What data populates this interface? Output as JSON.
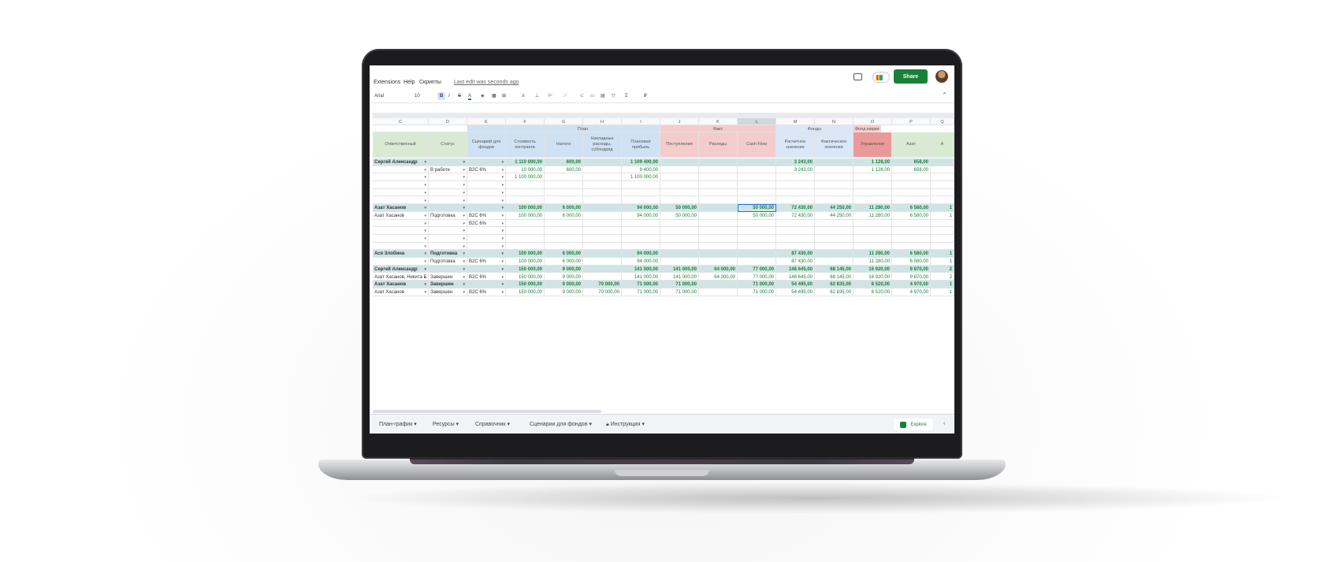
{
  "menu": {
    "items": [
      "Extensions",
      "Help",
      "Скрипты"
    ],
    "last_edit": "Last edit was seconds ago",
    "share": "Share"
  },
  "toolbar": {
    "font": "Arial",
    "size": "10",
    "bold": "B",
    "italic": "I",
    "strike": "S",
    "color": "A"
  },
  "columns": [
    {
      "letter": "C",
      "label": "Ответственный"
    },
    {
      "letter": "D",
      "label": "Статус"
    },
    {
      "letter": "E",
      "label": "Сценарий для фондов"
    },
    {
      "letter": "F",
      "label": "Стоимость контракта"
    },
    {
      "letter": "G",
      "label": "Налоги"
    },
    {
      "letter": "H",
      "label": "Накладные расходы, субподряд"
    },
    {
      "letter": "I",
      "label": "Плановая прибыль"
    },
    {
      "letter": "J",
      "label": "Поступления"
    },
    {
      "letter": "K",
      "label": "Расходы"
    },
    {
      "letter": "L",
      "label": "Cash Flow"
    },
    {
      "letter": "M",
      "label": "Расчетное значение"
    },
    {
      "letter": "N",
      "label": "Фактическое значение"
    },
    {
      "letter": "O",
      "label": "Управление"
    },
    {
      "letter": "P",
      "label": "Азат"
    },
    {
      "letter": "Q",
      "label": "А"
    }
  ],
  "groups": {
    "plan": "План",
    "fact": "Факт",
    "funds": "Фонды",
    "brand": "Фонд марки"
  },
  "rows": [
    {
      "g": true,
      "c": [
        "Сергей Александр",
        "",
        "",
        "1 110 000,00",
        "600,00",
        "",
        "1 109 400,00",
        "",
        "",
        "",
        "3 243,00",
        "",
        "1 128,00",
        "658,00",
        ""
      ]
    },
    {
      "g": false,
      "c": [
        "",
        "В работе",
        "B2C 6%",
        "10 000,00",
        "600,00",
        "",
        "9 400,00",
        "",
        "",
        "",
        "3 243,00",
        "",
        "1 128,00",
        "658,00",
        ""
      ]
    },
    {
      "g": false,
      "c": [
        "",
        "",
        "",
        "1 100 000,00",
        "",
        "",
        "1 100 000,00",
        "",
        "",
        "",
        "",
        "",
        "",
        "",
        ""
      ]
    },
    {
      "g": false,
      "c": [
        "",
        "",
        "",
        "",
        "",
        "",
        "",
        "",
        "",
        "",
        "",
        "",
        "",
        "",
        ""
      ]
    },
    {
      "g": false,
      "c": [
        "",
        "",
        "",
        "",
        "",
        "",
        "",
        "",
        "",
        "",
        "",
        "",
        "",
        "",
        ""
      ]
    },
    {
      "g": false,
      "c": [
        "",
        "",
        "",
        "",
        "",
        "",
        "",
        "",
        "",
        "",
        "",
        "",
        "",
        "",
        ""
      ]
    },
    {
      "g": true,
      "c": [
        "Азат Хасанов",
        "",
        "",
        "100 000,00",
        "6 000,00",
        "",
        "94 000,00",
        "50 000,00",
        "",
        "50 000,00",
        "72 430,00",
        "44 250,00",
        "11 280,00",
        "6 580,00",
        "1"
      ]
    },
    {
      "g": false,
      "c": [
        "Азат Хасанов",
        "Подготовка",
        "B2C 6%",
        "100 000,00",
        "6 000,00",
        "",
        "94 000,00",
        "50 000,00",
        "",
        "50 000,00",
        "72 430,00",
        "44 250,00",
        "11 280,00",
        "6 580,00",
        "1"
      ]
    },
    {
      "g": false,
      "c": [
        "",
        "",
        "B2C 6%",
        "",
        "",
        "",
        "",
        "",
        "",
        "",
        "",
        "",
        "",
        "",
        ""
      ]
    },
    {
      "g": false,
      "c": [
        "",
        "",
        "",
        "",
        "",
        "",
        "",
        "",
        "",
        "",
        "",
        "",
        "",
        "",
        ""
      ]
    },
    {
      "g": false,
      "c": [
        "",
        "",
        "",
        "",
        "",
        "",
        "",
        "",
        "",
        "",
        "",
        "",
        "",
        "",
        ""
      ]
    },
    {
      "g": false,
      "c": [
        "",
        "",
        "",
        "",
        "",
        "",
        "",
        "",
        "",
        "",
        "",
        "",
        "",
        "",
        ""
      ]
    },
    {
      "g": true,
      "c": [
        "Ася Злобина",
        "Подготовка",
        "",
        "100 000,00",
        "6 000,00",
        "",
        "94 000,00",
        "",
        "",
        "",
        "87 430,00",
        "",
        "11 280,00",
        "6 580,00",
        "1"
      ]
    },
    {
      "g": false,
      "c": [
        "",
        "Подготовка",
        "B2C 6%",
        "100 000,00",
        "6 000,00",
        "",
        "94 000,00",
        "",
        "",
        "",
        "87 430,00",
        "",
        "11 280,00",
        "6 580,00",
        "1"
      ]
    },
    {
      "g": true,
      "c": [
        "Сергей Александр",
        "",
        "",
        "150 000,00",
        "9 000,00",
        "",
        "141 000,00",
        "141 000,00",
        "64 000,00",
        "77 000,00",
        "148 645,00",
        "68 145,00",
        "16 920,00",
        "9 870,00",
        "2"
      ]
    },
    {
      "g": false,
      "c": [
        "Азат Хасанов, Никита Е",
        "Завершен",
        "B2C 6%",
        "150 000,00",
        "9 000,00",
        "",
        "141 000,00",
        "141 000,00",
        "64 000,00",
        "77 000,00",
        "148 645,00",
        "68 145,00",
        "16 920,00",
        "9 870,00",
        "2"
      ]
    },
    {
      "g": true,
      "c": [
        "Азат Хасанов",
        "Завершен",
        "",
        "150 000,00",
        "9 000,00",
        "70 000,00",
        "71 000,00",
        "71 000,00",
        "",
        "71 000,00",
        "54 495,00",
        "62 835,00",
        "8 520,00",
        "4 970,00",
        "1"
      ]
    },
    {
      "g": false,
      "c": [
        "Азат Хасанов",
        "Завершен",
        "B2C 6%",
        "150 000,00",
        "9 000,00",
        "70 000,00",
        "71 000,00",
        "71 000,00",
        "",
        "71 000,00",
        "54 495,00",
        "62 835,00",
        "8 520,00",
        "4 970,00",
        "1"
      ]
    }
  ],
  "sheets": [
    "План-график",
    "Ресурсы",
    "Справочник",
    "Сценарии для фондов",
    "Инструкция"
  ],
  "explore": "Explore",
  "colors": {
    "green": "#188038",
    "plan": "#cfe2f3",
    "fact": "#f4cccc",
    "funds": "#d9e7f6",
    "brand": "#ea9999",
    "group_row": "#d0e4e4"
  }
}
